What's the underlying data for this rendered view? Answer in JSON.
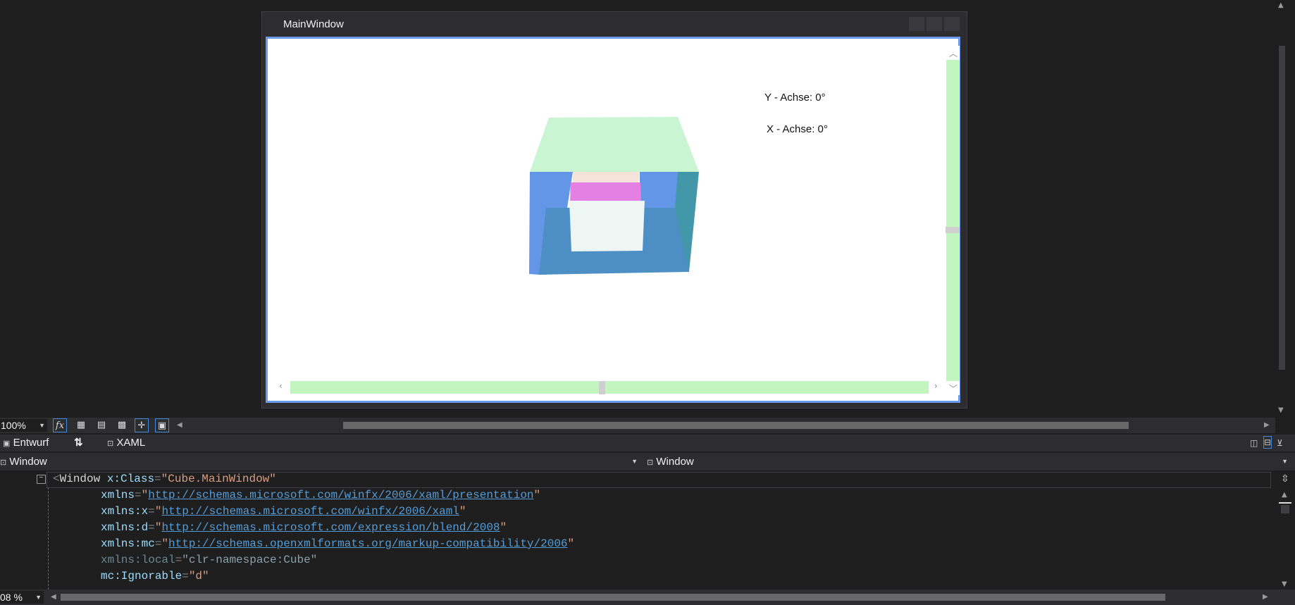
{
  "window": {
    "title": "MainWindow",
    "labels": {
      "y_axis": "Y - Achse: 0°",
      "x_axis": "X - Achse: 0°"
    }
  },
  "designer_toolbar": {
    "zoom": "100%",
    "fx": "fx"
  },
  "tabs": {
    "design": "Entwurf",
    "swap": "⇅",
    "xaml": "XAML"
  },
  "navbar": {
    "left_scope": "Window",
    "right_scope": "Window"
  },
  "code": {
    "line1": {
      "open": "<",
      "element": "Window",
      "attr": "x:Class",
      "value": "\"Cube.MainWindow\""
    },
    "line2": {
      "attr": "xmlns",
      "eq": "=",
      "q1": "\"",
      "url": "http://schemas.microsoft.com/winfx/2006/xaml/presentation",
      "q2": "\""
    },
    "line3": {
      "attr": "xmlns:x",
      "eq": "=",
      "q1": "\"",
      "url": "http://schemas.microsoft.com/winfx/2006/xaml",
      "q2": "\""
    },
    "line4": {
      "attr": "xmlns:d",
      "eq": "=",
      "q1": "\"",
      "url": "http://schemas.microsoft.com/expression/blend/2008",
      "q2": "\""
    },
    "line5": {
      "attr": "xmlns:mc",
      "eq": "=",
      "q1": "\"",
      "url": "http://schemas.openxmlformats.org/markup-compatibility/2006",
      "q2": "\""
    },
    "line6": {
      "attr": "xmlns:local",
      "eq": "=",
      "value": "\"clr-namespace:Cube\""
    },
    "line7": {
      "attr": "mc:Ignorable",
      "eq": "=",
      "value": "\"d\""
    }
  },
  "editor_footer": {
    "zoom": "08 %"
  },
  "colors": {
    "cube_top": "#c9f5d2",
    "cube_left": "#6396e6",
    "cube_right": "#4297a8",
    "cube_bottom": "#4d8fc4",
    "inner_back_top": "#f5e2d8",
    "inner_pink": "#e580e3",
    "inner_front": "#eef6f4",
    "slider_track": "#c2f5c0"
  }
}
